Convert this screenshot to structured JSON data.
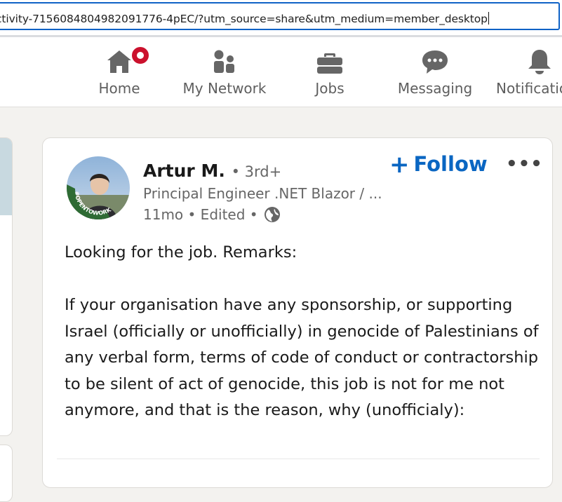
{
  "browser": {
    "url": "ctivity-7156084804982091776-4pEC/?utm_source=share&utm_medium=member_desktop"
  },
  "nav": {
    "items": [
      {
        "label": "Home",
        "icon": "home-icon",
        "badge": true
      },
      {
        "label": "My Network",
        "icon": "network-icon"
      },
      {
        "label": "Jobs",
        "icon": "briefcase-icon"
      },
      {
        "label": "Messaging",
        "icon": "messaging-icon"
      },
      {
        "label": "Notificatio",
        "icon": "bell-icon"
      }
    ]
  },
  "post": {
    "author_name": "Artur M.",
    "connection_degree": "• 3rd+",
    "headline": "Principal Engineer .NET Blazor / ...",
    "meta": "11mo • Edited •",
    "avatar_badge_text": "#OPENTOWORK",
    "follow_label": "Follow",
    "more_label": "•••",
    "body_intro": "Looking for the job. Remarks:",
    "body_paragraph": "If your organisation have any sponsorship, or supporting Israel (officially or unofficially) in genocide of Palestinians of any verbal form, terms of code of conduct or contractorship to be silent of act of genocide, this job is not for me not anymore, and that is the reason, why (unofficialy):"
  },
  "colors": {
    "accent": "#0a66c2",
    "badge": "#cb112d",
    "open_to_work": "#2e6b34",
    "background": "#f3f2ef"
  }
}
